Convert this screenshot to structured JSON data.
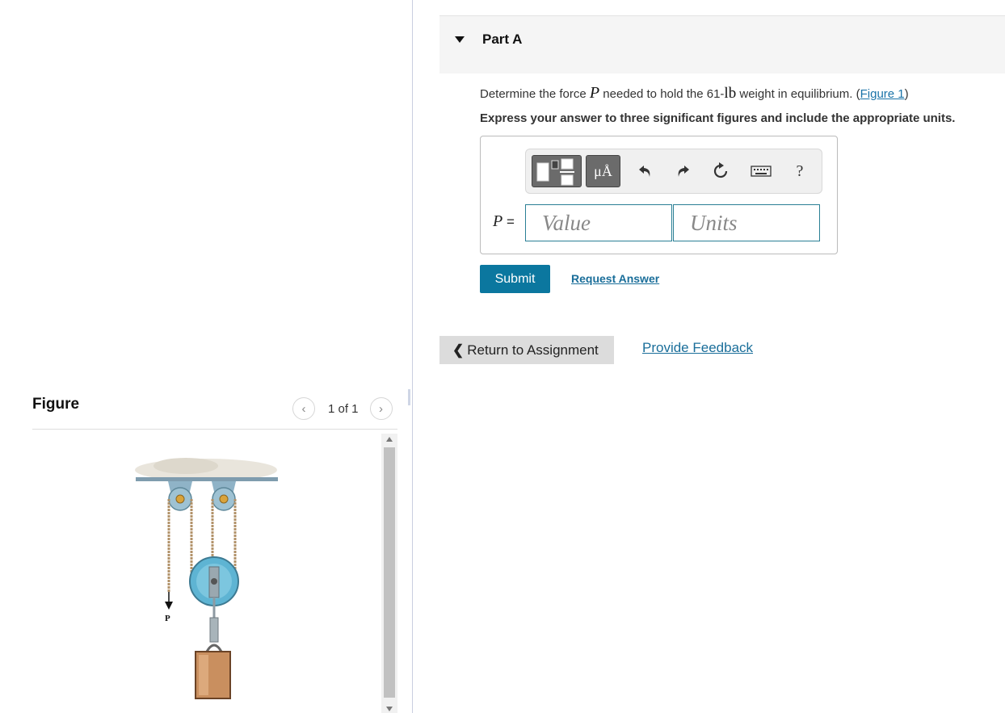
{
  "figure_panel": {
    "title": "Figure",
    "page_indicator": "1 of 1",
    "prev_icon": "chevron-left-icon",
    "next_icon": "chevron-right-icon",
    "image_label": "P"
  },
  "part": {
    "title": "Part A"
  },
  "question": {
    "prefix": "Determine the force ",
    "variable": "P",
    "middle": " needed to hold the 61-",
    "unit": "lb",
    "suffix": " weight in equilibrium. (",
    "figure_link": "Figure 1",
    "close": ")"
  },
  "instruction": "Express your answer to three significant figures and include the appropriate units.",
  "answer": {
    "label_var": "P",
    "label_eq": " =",
    "value_placeholder": "Value",
    "units_placeholder": "Units",
    "toolbar": {
      "templates_icon": "templates-icon",
      "units_button": "μÅ",
      "undo_icon": "undo-icon",
      "redo_icon": "redo-icon",
      "reset_icon": "reset-icon",
      "keyboard_icon": "keyboard-icon",
      "help": "?"
    }
  },
  "actions": {
    "submit": "Submit",
    "request_answer": "Request Answer",
    "return": "Return to Assignment",
    "feedback": "Provide Feedback"
  },
  "colors": {
    "accent": "#0b779f",
    "link": "#1a6e9a",
    "field_border": "#2a7f95"
  }
}
